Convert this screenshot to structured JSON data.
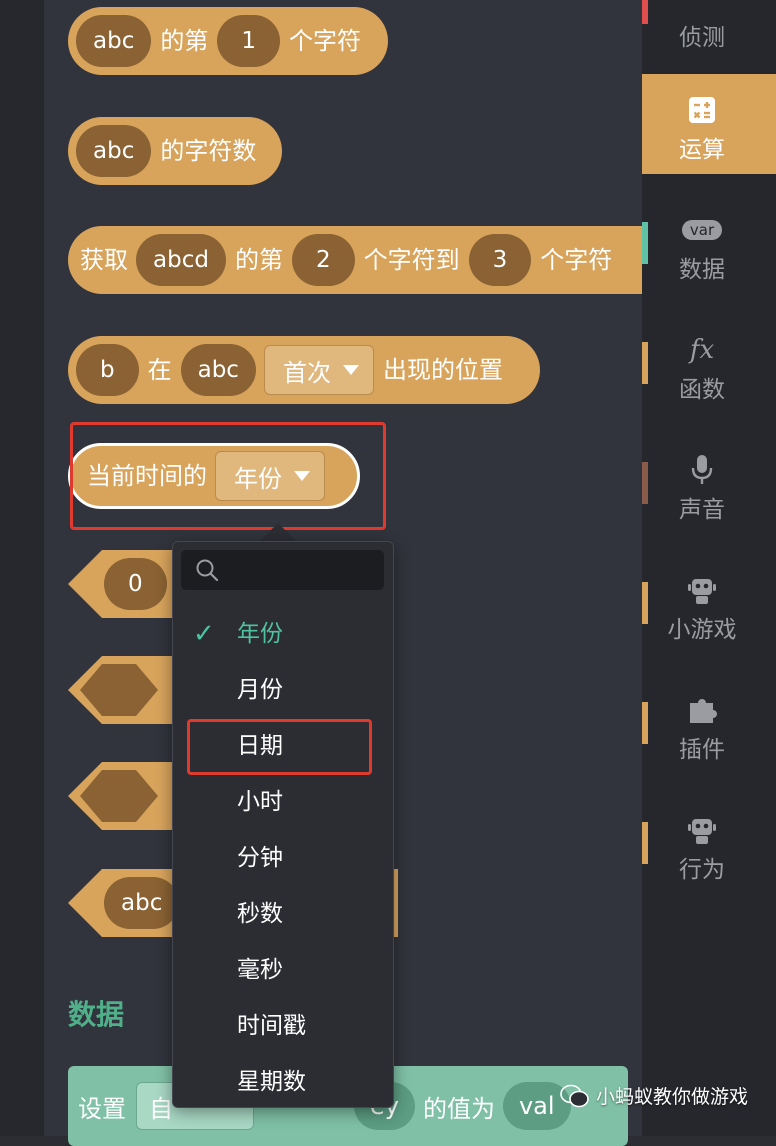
{
  "blocks": {
    "char_at": {
      "value": "abc",
      "t1": "的第",
      "index": "1",
      "t2": "个字符"
    },
    "char_count": {
      "value": "abc",
      "t1": "的字符数"
    },
    "substring": {
      "t0": "获取",
      "value": "abcd",
      "t1": "的第",
      "from": "2",
      "t2": "个字符到",
      "to": "3",
      "t3": "个字符"
    },
    "index_of": {
      "needle": "b",
      "t1": "在",
      "haystack": "abc",
      "mode": "首次",
      "t2": "出现的位置"
    },
    "current_time": {
      "t1": "当前时间的",
      "field": "年份"
    },
    "number_block": {
      "value": "0"
    },
    "text_block": {
      "value": "abc"
    }
  },
  "dropdown": {
    "items": [
      {
        "label": "年份",
        "selected": true
      },
      {
        "label": "月份",
        "selected": false
      },
      {
        "label": "日期",
        "selected": false
      },
      {
        "label": "小时",
        "selected": false
      },
      {
        "label": "分钟",
        "selected": false
      },
      {
        "label": "秒数",
        "selected": false
      },
      {
        "label": "毫秒",
        "selected": false
      },
      {
        "label": "时间戳",
        "selected": false
      },
      {
        "label": "星期数",
        "selected": false
      }
    ],
    "check_glyph": "✓"
  },
  "section": {
    "title": "数据"
  },
  "set_block": {
    "t0": "设置",
    "field": "自",
    "key": "ey",
    "t1": "的值为",
    "value": "val"
  },
  "sidebar": {
    "items": [
      {
        "label": "侦测",
        "icon": "detect-icon"
      },
      {
        "label": "运算",
        "icon": "calculator-icon",
        "active": true
      },
      {
        "label": "数据",
        "icon": "var-icon",
        "icon_text": "var"
      },
      {
        "label": "函数",
        "icon": "function-icon",
        "icon_text": "fx"
      },
      {
        "label": "声音",
        "icon": "microphone-icon"
      },
      {
        "label": "小游戏",
        "icon": "robot-icon"
      },
      {
        "label": "插件",
        "icon": "puzzle-icon"
      },
      {
        "label": "行为",
        "icon": "robot-icon"
      }
    ]
  },
  "watermark": "小蚂蚁教你做游戏",
  "colors": {
    "block": "#d8a45c",
    "pill": "#8a6233",
    "highlight": "#e03a2f",
    "check": "#4fc3a0",
    "data_section": "#4fb08a"
  }
}
